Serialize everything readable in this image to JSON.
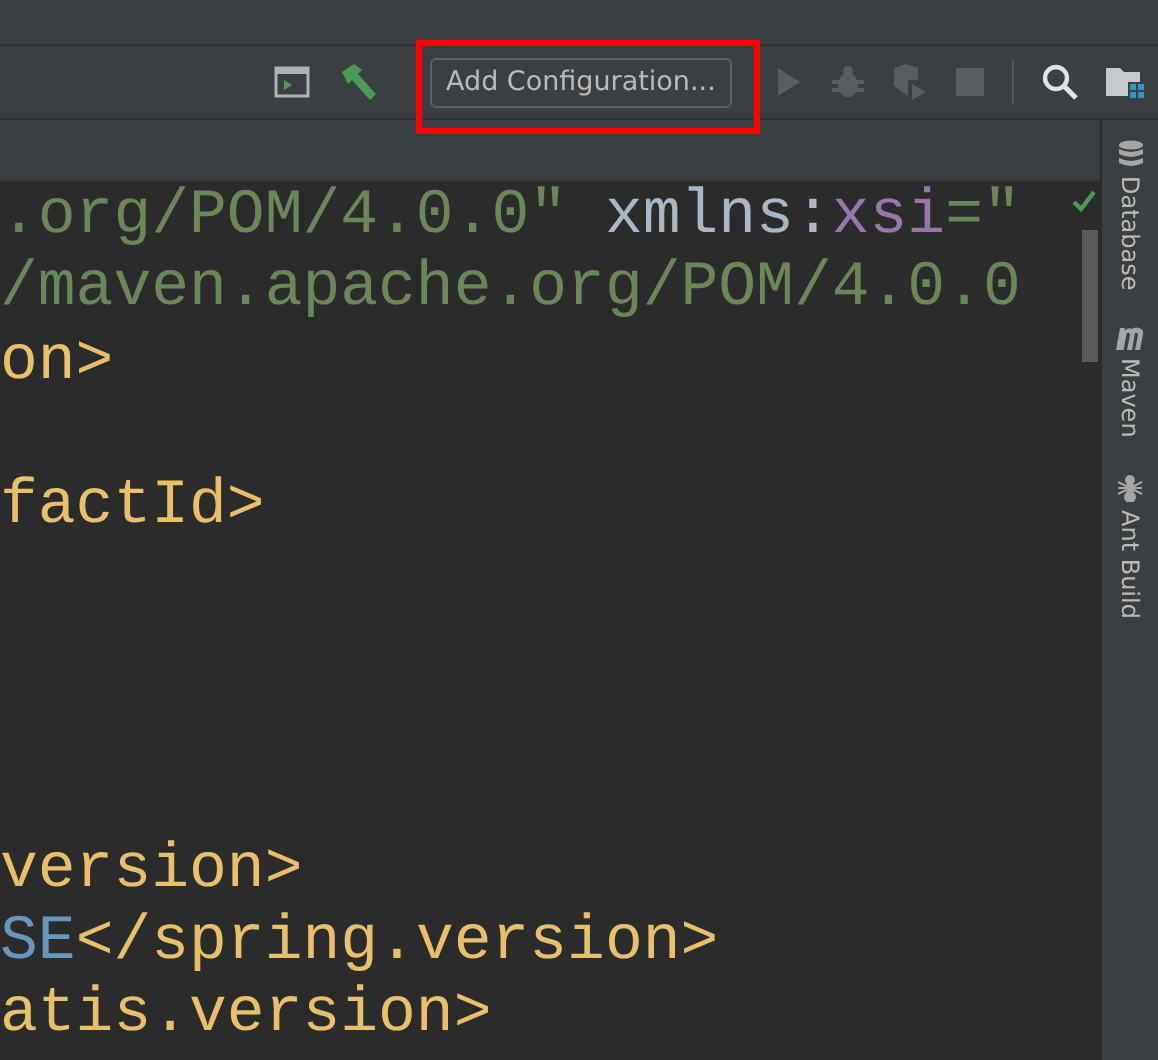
{
  "toolbar": {
    "tools": [
      {
        "kind": "terminal"
      },
      {
        "kind": "build"
      }
    ],
    "config_button": {
      "label": "Add Configuration...",
      "highlighted": true
    },
    "run_tools": [
      {
        "kind": "run",
        "disabled": true
      },
      {
        "kind": "debug",
        "disabled": true
      },
      {
        "kind": "coverage",
        "disabled": true
      },
      {
        "kind": "stop",
        "disabled": true
      }
    ],
    "end_tools": [
      {
        "kind": "search"
      },
      {
        "kind": "project-structure"
      }
    ]
  },
  "editor": {
    "lines": [
      {
        "tokens": [
          {
            "text": ".org/POM/4.0.0\"",
            "kind": "string"
          },
          {
            "text": " xmlns:",
            "kind": "plain"
          },
          {
            "text": "xsi",
            "kind": "attribute"
          },
          {
            "text": "=\"",
            "kind": "string"
          }
        ]
      },
      {
        "tokens": [
          {
            "text": "/maven.apache.org/POM/4.0.0",
            "kind": "string"
          }
        ]
      },
      {
        "tokens": [
          {
            "text": "on>",
            "kind": "tag"
          }
        ]
      },
      {
        "blank": true
      },
      {
        "tokens": [
          {
            "text": "factId>",
            "kind": "tag"
          }
        ]
      },
      {
        "blank": true
      },
      {
        "blank": true
      },
      {
        "blank": true
      },
      {
        "blank": true
      },
      {
        "tokens": [
          {
            "text": "version>",
            "kind": "tag"
          }
        ]
      },
      {
        "tokens": [
          {
            "text": "SE",
            "kind": "value"
          },
          {
            "text": "</spring.version>",
            "kind": "tag"
          }
        ]
      },
      {
        "tokens": [
          {
            "text": "atis.version>",
            "kind": "tag"
          }
        ]
      }
    ],
    "inspection_ok": true
  },
  "side_panel": {
    "tabs": [
      {
        "label": "Database",
        "kind": "database"
      },
      {
        "label": "Maven",
        "kind": "maven"
      },
      {
        "label": "Ant Build",
        "kind": "ant"
      }
    ]
  }
}
